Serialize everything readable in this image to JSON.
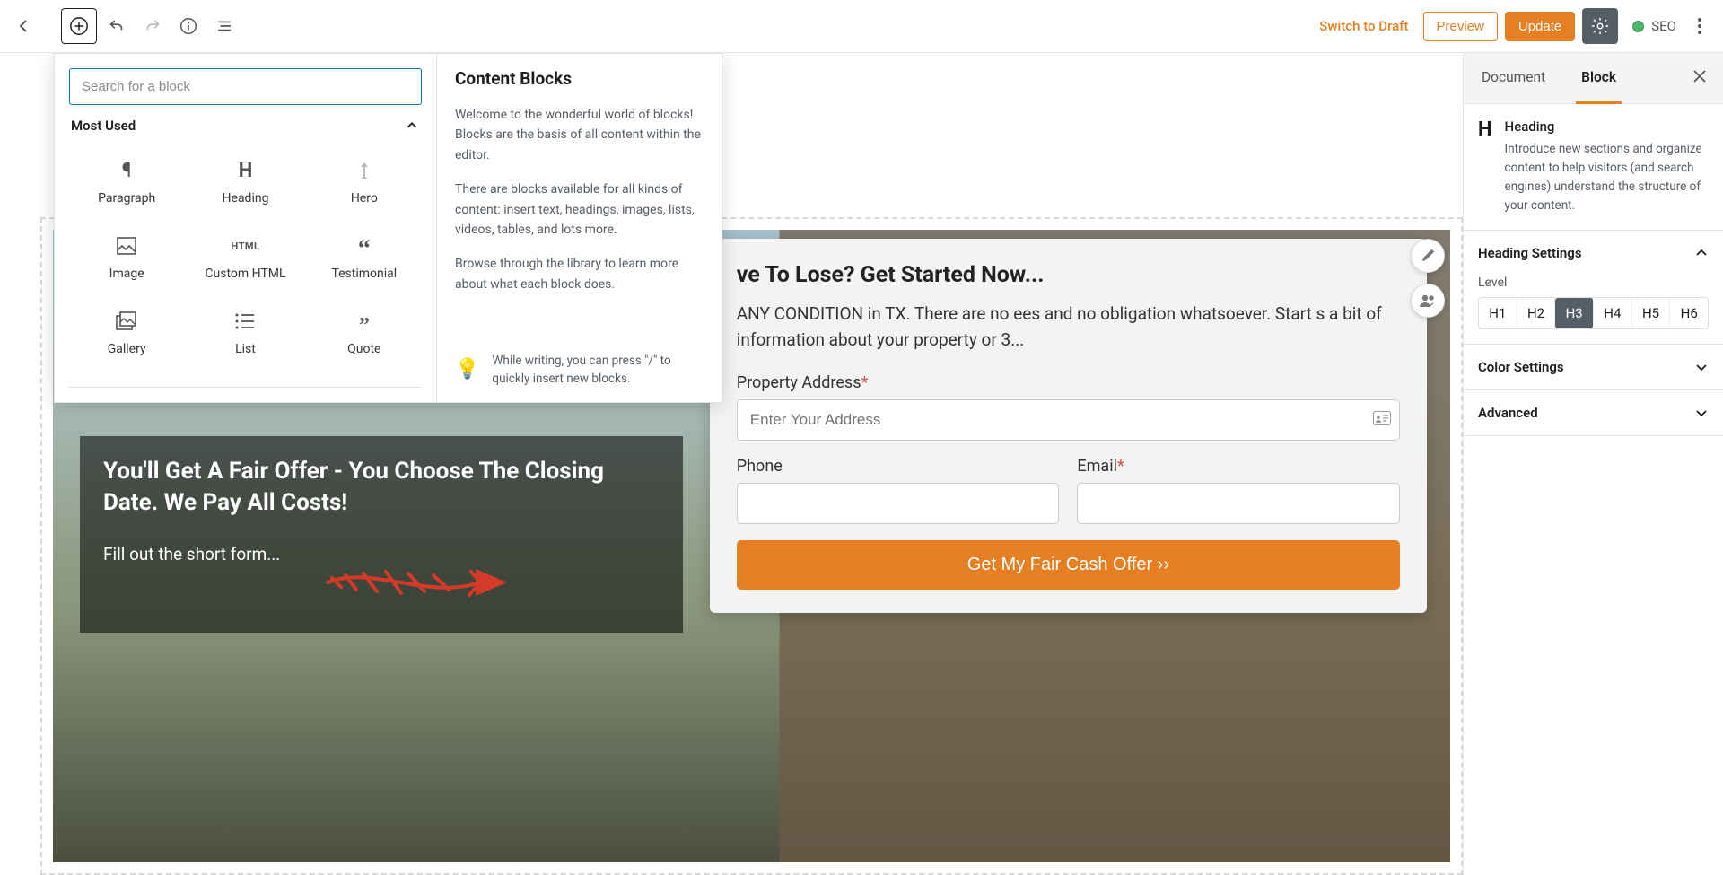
{
  "toolbar": {
    "switch_draft": "Switch to Draft",
    "preview": "Preview",
    "update": "Update",
    "seo_label": "SEO"
  },
  "inserter": {
    "search_placeholder": "Search for a block",
    "section_title": "Most Used",
    "blocks": [
      {
        "label": "Paragraph"
      },
      {
        "label": "Heading"
      },
      {
        "label": "Hero"
      },
      {
        "label": "Image"
      },
      {
        "label": "Custom HTML"
      },
      {
        "label": "Testimonial"
      },
      {
        "label": "Gallery"
      },
      {
        "label": "List"
      },
      {
        "label": "Quote"
      }
    ],
    "content_title": "Content Blocks",
    "content_p1": "Welcome to the wonderful world of blocks! Blocks are the basis of all content within the editor.",
    "content_p2": "There are blocks available for all kinds of content: insert text, headings, images, lists, videos, tables, and lots more.",
    "content_p3": "Browse through the library to learn more about what each block does.",
    "tip": "While writing, you can press \"/\" to quickly insert new blocks."
  },
  "hero": {
    "left_heading": "You'll Get A Fair Offer - You Choose The Closing Date. We Pay All Costs!",
    "left_sub": "Fill out the short form...",
    "form_heading": "ve To Lose? Get Started Now...",
    "form_body": "ANY CONDITION in TX. There are no ees and no obligation whatsoever. Start s a bit of information about your property or 3...",
    "addr_label": "Property Address",
    "addr_placeholder": "Enter Your Address",
    "phone_label": "Phone",
    "email_label": "Email",
    "submit": "Get My Fair Cash Offer ››"
  },
  "sidebar": {
    "tab_document": "Document",
    "tab_block": "Block",
    "block_name": "Heading",
    "block_desc": "Introduce new sections and organize content to help visitors (and search engines) understand the structure of your content.",
    "panel_heading_settings": "Heading Settings",
    "level_label": "Level",
    "levels": [
      "H1",
      "H2",
      "H3",
      "H4",
      "H5",
      "H6"
    ],
    "active_level": "H3",
    "panel_color": "Color Settings",
    "panel_advanced": "Advanced"
  }
}
